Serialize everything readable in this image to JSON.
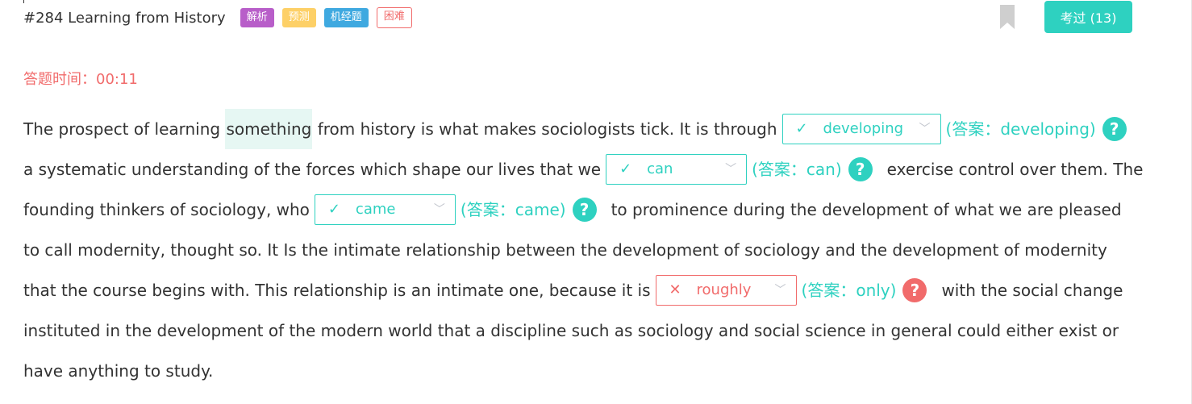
{
  "header": {
    "title": "#284 Learning from History",
    "tags": [
      {
        "label": "解析",
        "color": "#b85ec9"
      },
      {
        "label": "预测",
        "color": "#fdd067"
      },
      {
        "label": "机经题",
        "color": "#3fa9e0"
      },
      {
        "label": "困难",
        "color": "#f16b6b"
      }
    ],
    "exam_button": "考过 (13)",
    "exam_button_color": "#2ed1c0"
  },
  "timer": {
    "text": "答题时间：00:11",
    "color": "#f16b6b"
  },
  "passage": {
    "l1_a": "The prospect of learning",
    "l1_highlight": "something",
    "l1_b": "from history is what makes sociologists tick. It is through",
    "blank1": {
      "value": "developing",
      "answer": "(答案：developing)",
      "mark": "✓",
      "status": "correct"
    },
    "l2_a": "a systematic understanding of the forces which shape our lives that we",
    "blank2": {
      "value": "can",
      "answer": "(答案：can)",
      "mark": "✓",
      "status": "correct"
    },
    "l2_b": "exercise control over them. The",
    "l3_a": "founding thinkers of sociology, who",
    "blank3": {
      "value": "came",
      "answer": "(答案：came)",
      "mark": "✓",
      "status": "correct"
    },
    "l3_b": "to prominence during the development of what we are pleased",
    "l4": "to call modernity, thought so. It Is the intimate relationship between the development of sociology and the development of modernity",
    "l5_a": "that the course begins with. This relationship is an intimate one, because it is",
    "blank4": {
      "value": "roughly",
      "answer": "(答案：only)",
      "mark": "✕",
      "status": "wrong"
    },
    "l5_b": "with the social change",
    "l6": "instituted in the development of the modern world that a discipline such as sociology and social science in general could either exist or",
    "l7": "have anything to study."
  },
  "colors": {
    "correct": "#2ed1c0",
    "wrong": "#f16b6b",
    "text": "#333333",
    "chevron": "#c0c4cc",
    "bookmark": "#cfcfcf"
  },
  "icons": {
    "help": "?",
    "chevron": "﹀",
    "bookmark": "bookmark-icon"
  }
}
